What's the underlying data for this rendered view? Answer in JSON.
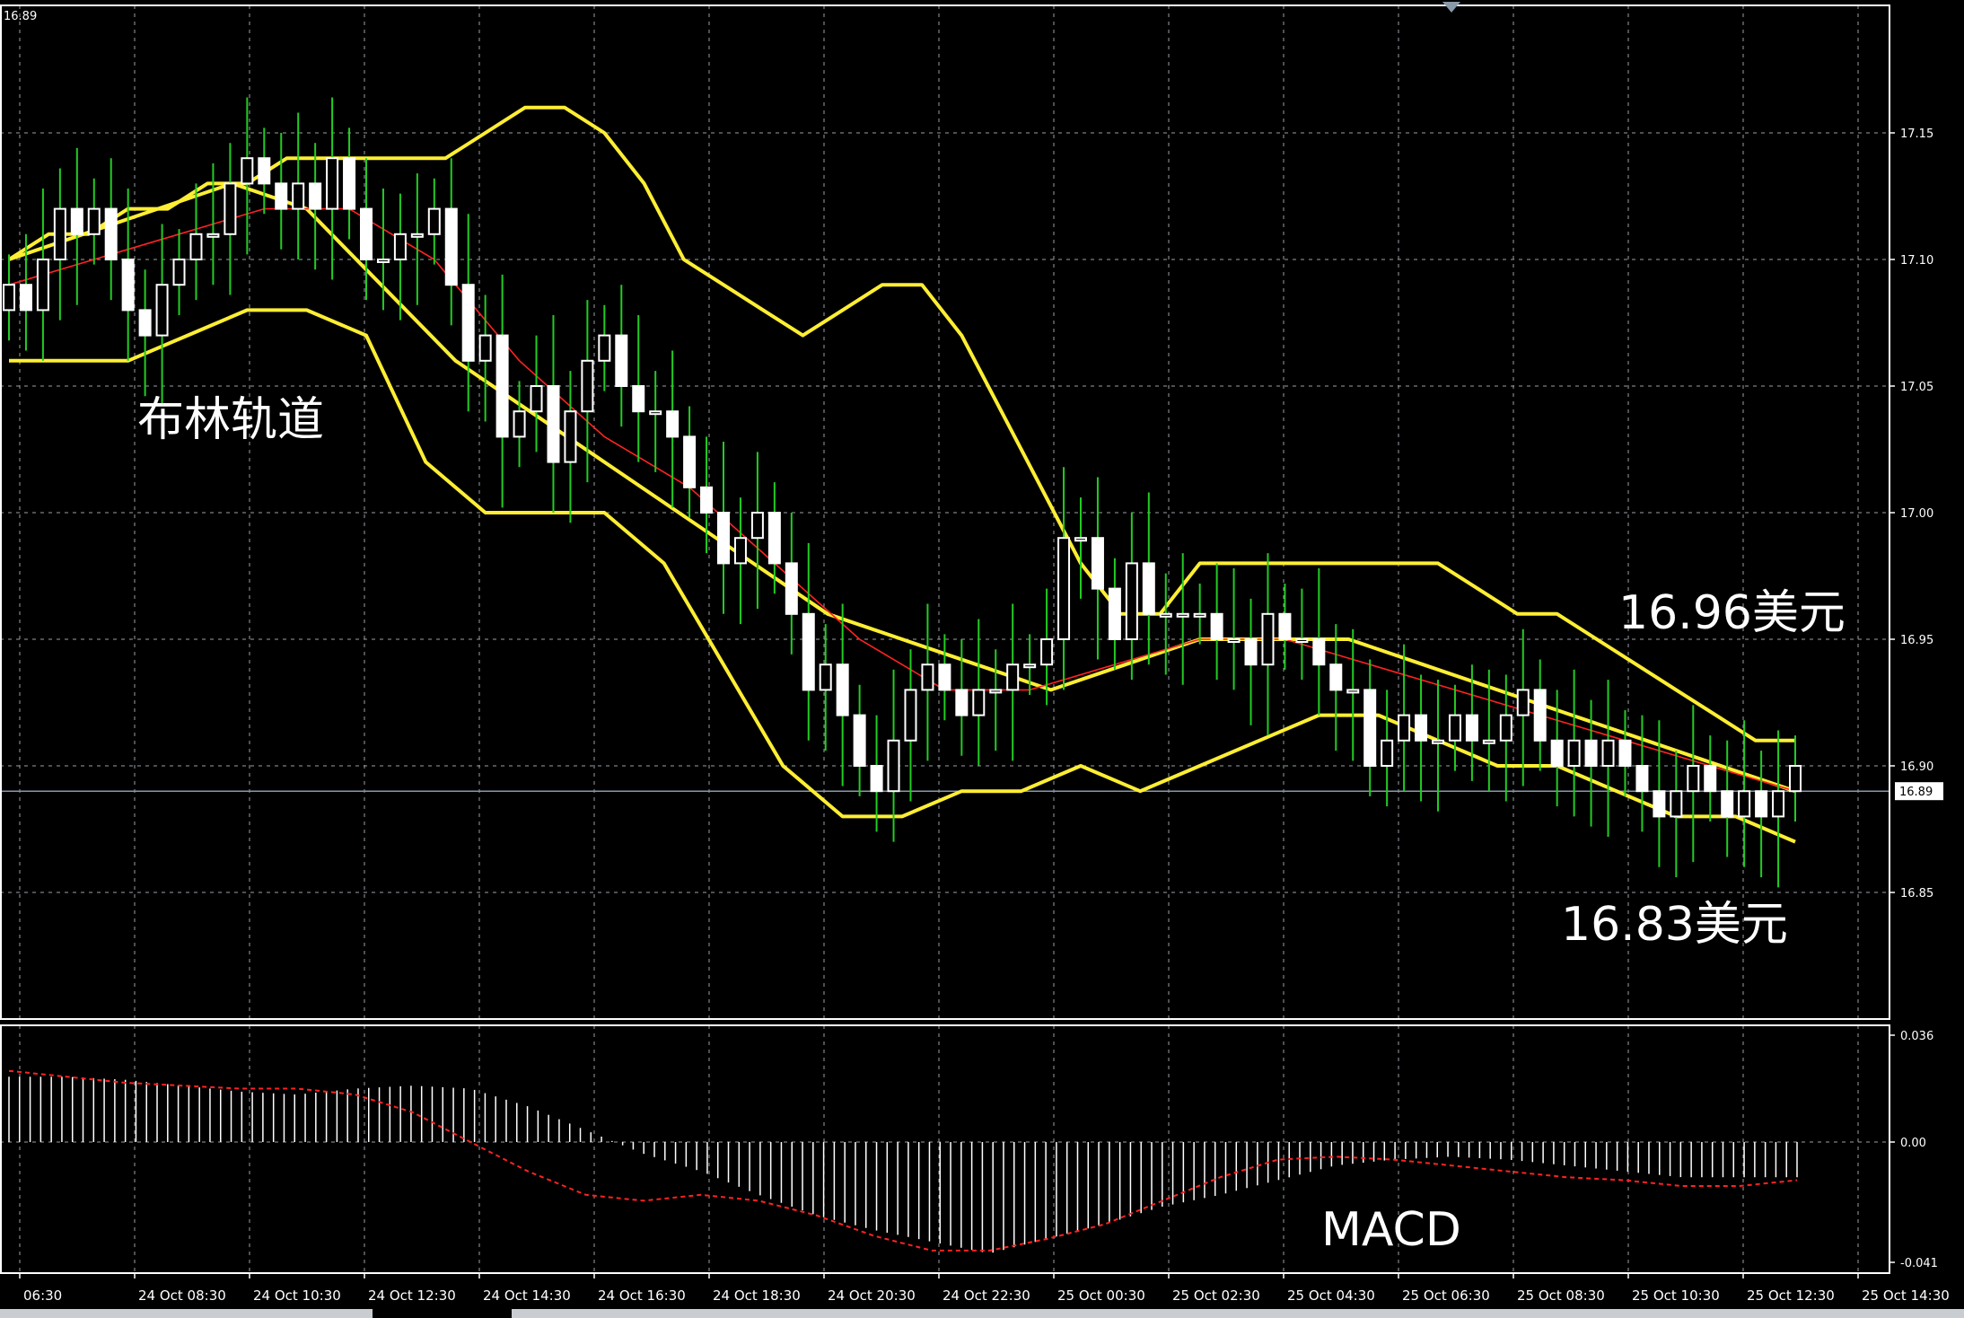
{
  "window": {
    "corner_price": "16.89"
  },
  "colors": {
    "background": "#000000",
    "grid": "#9aa0a6",
    "frame": "#ffffff",
    "bull_candle": "#ffffff",
    "bear_candle": "#ffffff",
    "wick": "#22cc22",
    "bollinger": "#ffee33",
    "ma": "#ff2222",
    "macd_hist": "#ffffff",
    "macd_signal": "#ff2222",
    "current_price_line": "#8899aa"
  },
  "annotations": {
    "bollinger_label": "布林轨道",
    "upper_price": "16.96美元",
    "lower_price": "16.83美元",
    "macd_label": "MACD"
  },
  "chart_data": [
    {
      "type": "candlestick",
      "title": "",
      "price_axis": {
        "ticks": [
          "17.15",
          "17.10",
          "17.05",
          "17.00",
          "16.95",
          "16.90",
          "16.85"
        ],
        "tick_values": [
          17.15,
          17.1,
          17.05,
          17.0,
          16.95,
          16.9,
          16.85
        ],
        "ylim": [
          16.8,
          17.2
        ]
      },
      "current_price": 16.89,
      "current_price_label": "16.89",
      "grid": true,
      "x_labels": [
        "06:30",
        "24 Oct 08:30",
        "24 Oct 10:30",
        "24 Oct 12:30",
        "24 Oct 14:30",
        "24 Oct 16:30",
        "24 Oct 18:30",
        "24 Oct 20:30",
        "24 Oct 22:30",
        "25 Oct 00:30",
        "25 Oct 02:30",
        "25 Oct 04:30",
        "25 Oct 06:30",
        "25 Oct 08:30",
        "25 Oct 10:30",
        "25 Oct 12:30",
        "25 Oct 14:30"
      ],
      "closes": [
        17.09,
        17.08,
        17.1,
        17.12,
        17.11,
        17.12,
        17.1,
        17.08,
        17.07,
        17.09,
        17.1,
        17.11,
        17.11,
        17.13,
        17.14,
        17.13,
        17.12,
        17.13,
        17.12,
        17.14,
        17.12,
        17.1,
        17.1,
        17.11,
        17.11,
        17.12,
        17.09,
        17.06,
        17.07,
        17.03,
        17.04,
        17.05,
        17.02,
        17.04,
        17.06,
        17.07,
        17.05,
        17.04,
        17.04,
        17.03,
        17.01,
        17.0,
        16.98,
        16.99,
        17.0,
        16.98,
        16.96,
        16.93,
        16.94,
        16.92,
        16.9,
        16.89,
        16.91,
        16.93,
        16.94,
        16.93,
        16.92,
        16.93,
        16.93,
        16.94,
        16.94,
        16.95,
        16.99,
        16.99,
        16.97,
        16.95,
        16.98,
        16.96,
        16.96,
        16.96,
        16.96,
        16.95,
        16.95,
        16.94,
        16.96,
        16.95,
        16.95,
        16.94,
        16.93,
        16.93,
        16.9,
        16.91,
        16.92,
        16.91,
        16.91,
        16.92,
        16.91,
        16.91,
        16.92,
        16.93,
        16.91,
        16.9,
        16.91,
        16.9,
        16.91,
        16.9,
        16.89,
        16.88,
        16.89,
        16.9,
        16.89,
        16.88,
        16.89,
        16.88,
        16.89,
        16.9
      ],
      "bollinger": {
        "upper": [
          17.1,
          17.11,
          17.11,
          17.12,
          17.12,
          17.13,
          17.13,
          17.14,
          17.14,
          17.14,
          17.14,
          17.14,
          17.15,
          17.16,
          17.16,
          17.15,
          17.13,
          17.1,
          17.09,
          17.08,
          17.07,
          17.08,
          17.09,
          17.09,
          17.07,
          17.04,
          17.01,
          16.98,
          16.96,
          16.96,
          16.98,
          16.98,
          16.98,
          16.98,
          16.98,
          16.98,
          16.98,
          16.97,
          16.96,
          16.96,
          16.95,
          16.94,
          16.93,
          16.92,
          16.91,
          16.91
        ],
        "middle": [
          17.1,
          17.11,
          17.12,
          17.13,
          17.12,
          17.09,
          17.06,
          17.04,
          17.02,
          17.0,
          16.98,
          16.96,
          16.95,
          16.94,
          16.93,
          16.94,
          16.95,
          16.95,
          16.95,
          16.94,
          16.93,
          16.92,
          16.91,
          16.9,
          16.89
        ],
        "lower": [
          17.06,
          17.06,
          17.06,
          17.07,
          17.08,
          17.08,
          17.07,
          17.02,
          17.0,
          17.0,
          17.0,
          16.98,
          16.94,
          16.9,
          16.88,
          16.88,
          16.89,
          16.89,
          16.9,
          16.89,
          16.9,
          16.91,
          16.92,
          16.92,
          16.91,
          16.9,
          16.9,
          16.89,
          16.88,
          16.88,
          16.87
        ]
      },
      "ma": [
        17.09,
        17.1,
        17.11,
        17.12,
        17.12,
        17.1,
        17.06,
        17.03,
        17.01,
        16.98,
        16.95,
        16.93,
        16.93,
        16.94,
        16.95,
        16.95,
        16.94,
        16.93,
        16.92,
        16.91,
        16.9,
        16.89
      ]
    },
    {
      "type": "bar",
      "title": "MACD",
      "y_ticks": [
        "0.036",
        "0.00",
        "-0.041"
      ],
      "ylim": [
        -0.041,
        0.036
      ],
      "histogram": [
        0.022,
        0.022,
        0.021,
        0.019,
        0.017,
        0.016,
        0.018,
        0.019,
        0.018,
        0.012,
        0.004,
        -0.004,
        -0.01,
        -0.018,
        -0.025,
        -0.03,
        -0.034,
        -0.038,
        -0.033,
        -0.028,
        -0.022,
        -0.018,
        -0.013,
        -0.008,
        -0.006,
        -0.005,
        -0.006,
        -0.008,
        -0.01,
        -0.012,
        -0.012,
        -0.012
      ],
      "signal": [
        0.024,
        0.022,
        0.02,
        0.019,
        0.018,
        0.018,
        0.016,
        0.01,
        0.0,
        -0.01,
        -0.018,
        -0.02,
        -0.018,
        -0.02,
        -0.025,
        -0.032,
        -0.037,
        -0.037,
        -0.033,
        -0.028,
        -0.02,
        -0.012,
        -0.006,
        -0.005,
        -0.006,
        -0.008,
        -0.01,
        -0.012,
        -0.013,
        -0.015,
        -0.015,
        -0.013
      ]
    }
  ]
}
